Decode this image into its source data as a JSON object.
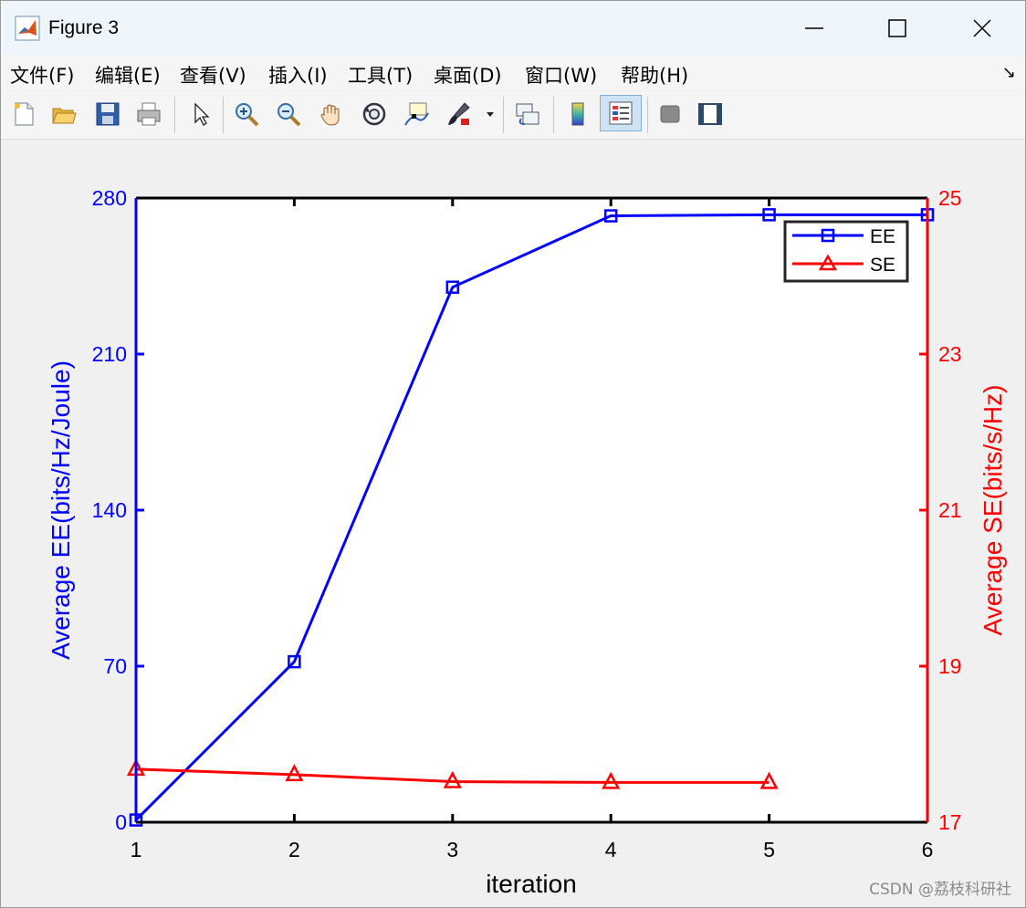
{
  "window": {
    "title": "Figure 3"
  },
  "menu": [
    "文件(F)",
    "编辑(E)",
    "查看(V)",
    "插入(I)",
    "工具(T)",
    "桌面(D)",
    "窗口(W)",
    "帮助(H)"
  ],
  "toolbar": [
    "new-figure-icon",
    "open-icon",
    "save-icon",
    "print-icon",
    "select-arrow-icon",
    "zoom-in-icon",
    "zoom-out-icon",
    "pan-hand-icon",
    "rotate-3d-icon",
    "data-cursor-icon",
    "brush-icon",
    "link-plot-icon",
    "colorbar-icon",
    "legend-icon",
    "hide-plot-tools-icon",
    "show-plot-tools-icon"
  ],
  "chart_data": {
    "type": "line",
    "x": [
      1,
      2,
      3,
      4,
      5,
      6
    ],
    "xlabel": "iteration",
    "xlim": [
      1,
      6
    ],
    "xticks": [
      1,
      2,
      3,
      4,
      5,
      6
    ],
    "grid": false,
    "legend_position": "top-right",
    "y_left": {
      "label": "Average EE(bits/Hz/Joule)",
      "lim": [
        0,
        280
      ],
      "ticks": [
        0,
        70,
        140,
        210,
        280
      ],
      "color": "#0000ff"
    },
    "y_right": {
      "label": "Average SE(bits/s/Hz)",
      "lim": [
        17,
        25
      ],
      "ticks": [
        17,
        19,
        21,
        23,
        25
      ],
      "color": "#ff0000"
    },
    "series": [
      {
        "name": "EE",
        "axis": "left",
        "color": "#0000ff",
        "marker": "square",
        "x": [
          1,
          2,
          3,
          4,
          5,
          6
        ],
        "values": [
          1,
          72,
          240,
          272,
          272.5,
          272.5
        ]
      },
      {
        "name": "SE",
        "axis": "right",
        "color": "#ff0000",
        "marker": "triangle",
        "x": [
          1,
          2,
          3,
          4,
          5
        ],
        "values": [
          17.68,
          17.61,
          17.52,
          17.51,
          17.51
        ]
      }
    ]
  },
  "watermark": "CSDN @荔枝科研社"
}
